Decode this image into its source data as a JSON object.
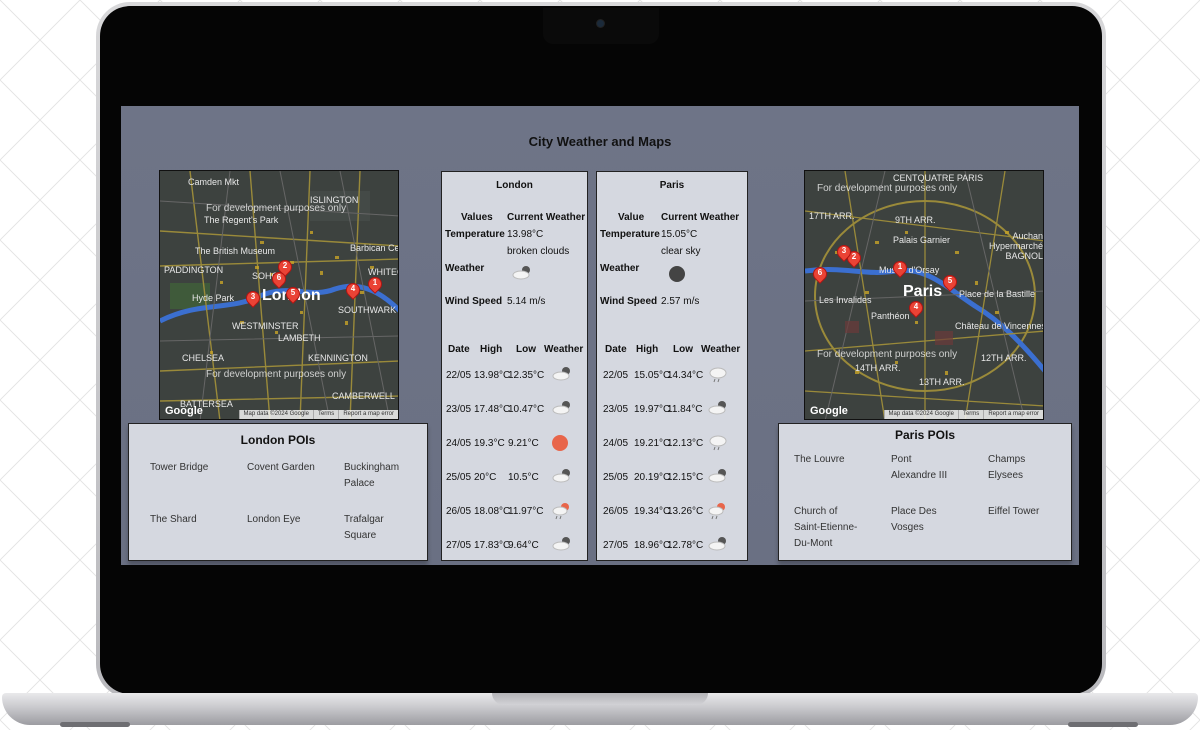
{
  "page": {
    "title": "City Weather and Maps"
  },
  "colors": {
    "screen_bg": "#6e7487",
    "panel_bg": "#d5d8e0",
    "pin": "#ea4335",
    "sun": "#e8654a"
  },
  "maps": {
    "dev_text": "For development purposes only",
    "footer": {
      "data": "Map data ©2024 Google",
      "terms": "Terms",
      "report": "Report a map error"
    },
    "logo": "Google",
    "london": {
      "labels": [
        "Camden Mkt",
        "ISLINGTON",
        "The Regent's Park",
        "The British Museum",
        "Barbican Cen",
        "PADDINGTON",
        "SOHO",
        "Hyde Park",
        "WESTMINSTER",
        "LAMBETH",
        "CHELSEA",
        "CAMBERWELL",
        "BATTERSEA",
        "SOUTHWARK",
        "WHITEC",
        "KENNINGTON"
      ],
      "city": "London",
      "pins": [
        "1",
        "2",
        "3",
        "4",
        "5",
        "6"
      ]
    },
    "paris": {
      "labels": [
        "CENTQUATRE PARIS",
        "17TH ARR.",
        "9TH ARR.",
        "Palais Garnier",
        "Auchan Hypermarché BAGNOL",
        "Musée d'Orsay",
        "Les Invalides",
        "Place de la Bastille",
        "Panthéon",
        "Château de Vincennes",
        "14TH ARR.",
        "13TH ARR.",
        "12TH ARR."
      ],
      "city": "Paris",
      "pins": [
        "1",
        "2",
        "3",
        "4",
        "5",
        "6"
      ]
    }
  },
  "london": {
    "city": "London",
    "head_values": "Values",
    "head_current": "Current Weather",
    "temp_label": "Temperature",
    "temp": "13.98°C",
    "desc": "broken clouds",
    "weather_label": "Weather",
    "weather_icon": "broken-clouds-icon",
    "wind_label": "Wind Speed",
    "wind": "5.14 m/s",
    "forecast_headers": [
      "Date",
      "High",
      "Low",
      "Weather"
    ],
    "forecast": [
      {
        "date": "22/05",
        "high": "13.98°C",
        "low": "12.35°C",
        "icon": "broken-clouds-icon"
      },
      {
        "date": "23/05",
        "high": "17.48°C",
        "low": "10.47°C",
        "icon": "broken-clouds-icon"
      },
      {
        "date": "24/05",
        "high": "19.3°C",
        "low": "9.21°C",
        "icon": "sun-icon"
      },
      {
        "date": "25/05",
        "high": "20°C",
        "low": "10.5°C",
        "icon": "broken-clouds-icon"
      },
      {
        "date": "26/05",
        "high": "18.08°C",
        "low": "11.97°C",
        "icon": "sun-rain-icon"
      },
      {
        "date": "27/05",
        "high": "17.83°C",
        "low": "9.64°C",
        "icon": "broken-clouds-icon"
      }
    ]
  },
  "paris": {
    "city": "Paris",
    "head_values": "Value",
    "head_current": "Current Weather",
    "temp_label": "Temperature",
    "temp": "15.05°C",
    "desc": "clear sky",
    "weather_label": "Weather",
    "weather_icon": "clear-sky-icon",
    "wind_label": "Wind Speed",
    "wind": "2.57 m/s",
    "forecast_headers": [
      "Date",
      "High",
      "Low",
      "Weather"
    ],
    "forecast": [
      {
        "date": "22/05",
        "high": "15.05°C",
        "low": "14.34°C",
        "icon": "rain-icon"
      },
      {
        "date": "23/05",
        "high": "19.97°C",
        "low": "11.84°C",
        "icon": "broken-clouds-icon"
      },
      {
        "date": "24/05",
        "high": "19.21°C",
        "low": "12.13°C",
        "icon": "rain-icon"
      },
      {
        "date": "25/05",
        "high": "20.19°C",
        "low": "12.15°C",
        "icon": "broken-clouds-icon"
      },
      {
        "date": "26/05",
        "high": "19.34°C",
        "low": "13.26°C",
        "icon": "sun-rain-icon"
      },
      {
        "date": "27/05",
        "high": "18.96°C",
        "low": "12.78°C",
        "icon": "broken-clouds-icon"
      }
    ]
  },
  "london_pois": {
    "title": "London POIs",
    "items": [
      "Tower Bridge",
      "Covent Garden",
      "Buckingham Palace",
      "The Shard",
      "London Eye",
      "Trafalgar Square"
    ]
  },
  "paris_pois": {
    "title": "Paris POIs",
    "items": [
      "The Louvre",
      "Pont Alexandre III",
      "Champs Elysees",
      "Church of Saint-Etienne-Du-Mont",
      "Place Des Vosges",
      "Eiffel Tower"
    ]
  }
}
